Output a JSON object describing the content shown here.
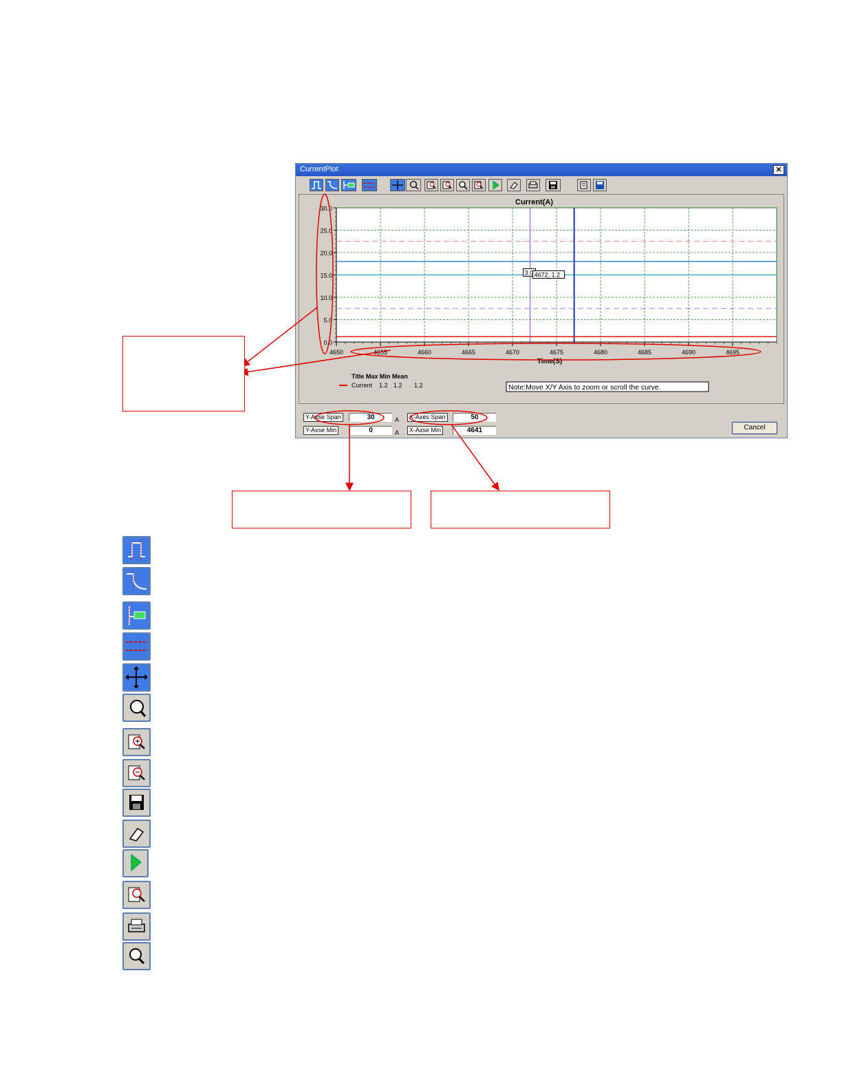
{
  "window": {
    "title": "CurrentPlot",
    "close_glyph": "✕"
  },
  "chart_data": {
    "type": "line",
    "title": "Current(A)",
    "xlabel": "Time(S)",
    "ylabel": "",
    "xlim": [
      4650,
      4700
    ],
    "ylim": [
      0,
      30
    ],
    "x_ticks": [
      "4650",
      "4655",
      "4660",
      "4665",
      "4670",
      "4675",
      "4680",
      "4685",
      "4690",
      "4695"
    ],
    "y_ticks": [
      "0.0",
      "5.0",
      "10.0",
      "15.0",
      "20.0",
      "25.0",
      "30.0"
    ],
    "grid": true,
    "series": [
      {
        "name": "Current",
        "x": [
          4650,
          4700
        ],
        "y": [
          1.2,
          1.2
        ],
        "color": "#e00000"
      }
    ],
    "reference_lines": [
      {
        "y": 22.5,
        "color": "#f08080",
        "style": "dashed"
      },
      {
        "y": 18.0,
        "color": "#1e6fbf",
        "style": "solid"
      },
      {
        "y": 15.0,
        "color": "#1fa3c8",
        "style": "solid"
      },
      {
        "y": 7.5,
        "color": "#8a8ae8",
        "style": "dashed"
      }
    ],
    "cursors": [
      {
        "x": 4672,
        "color": "#8a44d8"
      },
      {
        "x": 4677,
        "color": "#1c2fc8"
      }
    ],
    "cursor_labels": [
      "3.0",
      "4672, 1.2"
    ],
    "legend": {
      "header": "Title   Max Min Mean",
      "entries": [
        {
          "name": "Current",
          "max": "1.2",
          "min": "1.2",
          "mean": "1.2"
        }
      ]
    },
    "note": "Note:Move X/Y Axis to zoom or scroll the curve."
  },
  "controls": {
    "y_span_label": "Y-Axse Span",
    "y_span_value": "30",
    "y_min_label": "Y-Axse Min",
    "y_min_value": "0",
    "y_unit": "A",
    "x_span_label": "X-Axes Span",
    "x_span_value": "50",
    "x_min_label": "X-Axse Min",
    "x_min_value": "4641",
    "cancel_label": "Cancel"
  },
  "toolbar_icons": [
    "step-icon",
    "curve-step-icon",
    "cursor-readout-icon",
    "dashed-limits-icon",
    "pan-icon",
    "zoom-area-icon",
    "zoom-in-icon",
    "zoom-out-icon",
    "zoom-icon",
    "zoom-reset-icon",
    "play-icon",
    "eraser-icon",
    "print-icon",
    "save-icon",
    "copy-icon",
    "save-as-icon"
  ],
  "legend_icons": [
    "step-icon",
    "curve-step-icon",
    "cursor-readout-icon",
    "dashed-limits-icon",
    "pan-icon",
    "zoom-area-icon",
    "zoom-in-icon",
    "zoom-out-icon",
    "save-icon",
    "eraser-icon",
    "play-icon",
    "zoom-reset-icon",
    "print-icon",
    "zoom-icon"
  ],
  "colors": {
    "accent_red": "#e00000",
    "titlebar": "#2458c9",
    "button_blue": "#3f7ae5"
  }
}
